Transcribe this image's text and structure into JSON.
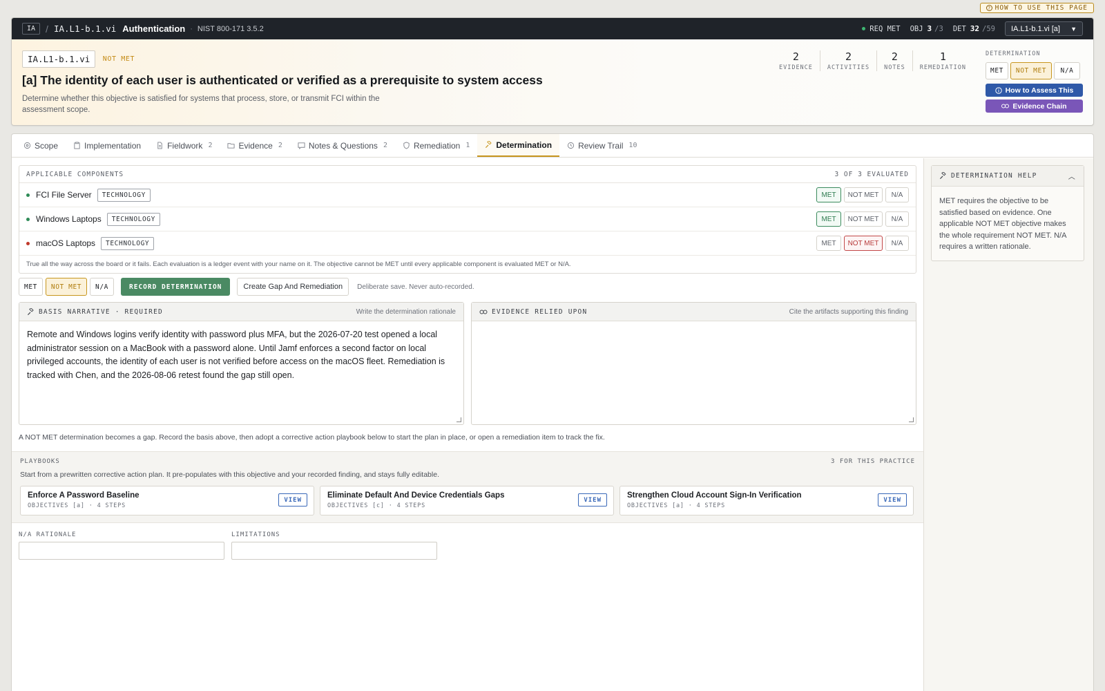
{
  "howto": {
    "label": "HOW TO USE THIS PAGE"
  },
  "topbar": {
    "badge": "IA",
    "code": "IA.L1-b.1.vi",
    "title": "Authentication",
    "ref": "NIST 800-171 3.5.2",
    "req_label": "REQ MET",
    "obj_label": "OBJ",
    "obj_value": "3",
    "obj_total": "/3",
    "det_label": "DET",
    "det_value": "32",
    "det_total": "/59",
    "selector_value": "IA.L1-b.1.vi [a]"
  },
  "header": {
    "code": "IA.L1-b.1.vi",
    "status": "NOT MET",
    "title": "[a] The identity of each user is authenticated or verified as a prerequisite to system access",
    "description": "Determine whether this objective is satisfied for systems that process, store, or transmit FCI within the assessment scope.",
    "metrics": [
      {
        "value": "2",
        "label": "EVIDENCE"
      },
      {
        "value": "2",
        "label": "ACTIVITIES"
      },
      {
        "value": "2",
        "label": "NOTES"
      },
      {
        "value": "1",
        "label": "REMEDIATION"
      }
    ],
    "determination_label": "DETERMINATION",
    "determination_options": [
      "MET",
      "NOT MET",
      "N/A"
    ],
    "determination_selected": "NOT MET",
    "how_to_assess": "How to Assess This",
    "evidence_chain": "Evidence Chain"
  },
  "tabs": [
    {
      "label": "Scope",
      "count": "",
      "icon": "scope-icon"
    },
    {
      "label": "Implementation",
      "count": "",
      "icon": "clipboard-icon"
    },
    {
      "label": "Fieldwork",
      "count": "2",
      "icon": "document-icon"
    },
    {
      "label": "Evidence",
      "count": "2",
      "icon": "folder-icon"
    },
    {
      "label": "Notes & Questions",
      "count": "2",
      "icon": "comment-icon"
    },
    {
      "label": "Remediation",
      "count": "1",
      "icon": "shield-icon"
    },
    {
      "label": "Determination",
      "count": "",
      "icon": "gavel-icon",
      "active": true
    },
    {
      "label": "Review Trail",
      "count": "10",
      "icon": "history-icon"
    }
  ],
  "components": {
    "heading": "APPLICABLE COMPONENTS",
    "evaluated": "3 OF 3 EVALUATED",
    "rows": [
      {
        "name": "FCI File Server",
        "tag": "TECHNOLOGY",
        "status": "MET",
        "dot": "#2e8b57"
      },
      {
        "name": "Windows Laptops",
        "tag": "TECHNOLOGY",
        "status": "MET",
        "dot": "#2e8b57"
      },
      {
        "name": "macOS Laptops",
        "tag": "TECHNOLOGY",
        "status": "NOT MET",
        "dot": "#c0392b"
      }
    ],
    "options": [
      "MET",
      "NOT MET",
      "N/A"
    ],
    "note": "True all the way across the board or it fails. Each evaluation is a ledger event with your name on it. The objective cannot be MET until every applicable component is evaluated MET or N/A."
  },
  "actions": {
    "options": [
      "MET",
      "NOT MET",
      "N/A"
    ],
    "selected": "NOT MET",
    "record": "RECORD DETERMINATION",
    "gap": "Create Gap And Remediation",
    "hint": "Deliberate save. Never auto-recorded."
  },
  "narrative": {
    "heading": "BASIS NARRATIVE · REQUIRED",
    "hint": "Write the determination rationale",
    "text": "Remote and Windows logins verify identity with password plus MFA, but the 2026-07-20 test opened a local administrator session on a MacBook with a password alone. Until Jamf enforces a second factor on local privileged accounts, the identity of each user is not verified before access on the macOS fleet. Remediation is tracked with Chen, and the 2026-08-06 retest found the gap still open."
  },
  "evidence": {
    "heading": "EVIDENCE RELIED UPON",
    "hint": "Cite the artifacts supporting this finding"
  },
  "gap_note": "A NOT MET determination becomes a gap. Record the basis above, then adopt a corrective action playbook below to start the plan in place, or open a remediation item to track the fix.",
  "playbooks": {
    "heading": "PLAYBOOKS",
    "count": "3 FOR THIS PRACTICE",
    "description": "Start from a prewritten corrective action plan. It pre-populates with this objective and your recorded finding, and stays fully editable.",
    "items": [
      {
        "title": "Enforce A Password Baseline",
        "meta": "OBJECTIVES [a] · 4 STEPS",
        "action": "VIEW"
      },
      {
        "title": "Eliminate Default And Device Credentials Gaps",
        "meta": "OBJECTIVES [c] · 4 STEPS",
        "action": "VIEW"
      },
      {
        "title": "Strengthen Cloud Account Sign-In Verification",
        "meta": "OBJECTIVES [a] · 4 STEPS",
        "action": "VIEW"
      }
    ]
  },
  "fields": {
    "na_label": "N/A RATIONALE",
    "limitations_label": "LIMITATIONS"
  },
  "help": {
    "heading": "DETERMINATION HELP",
    "text": "MET requires the objective to be satisfied based on evidence. One applicable NOT MET objective makes the whole requirement NOT MET. N/A requires a written rationale."
  }
}
